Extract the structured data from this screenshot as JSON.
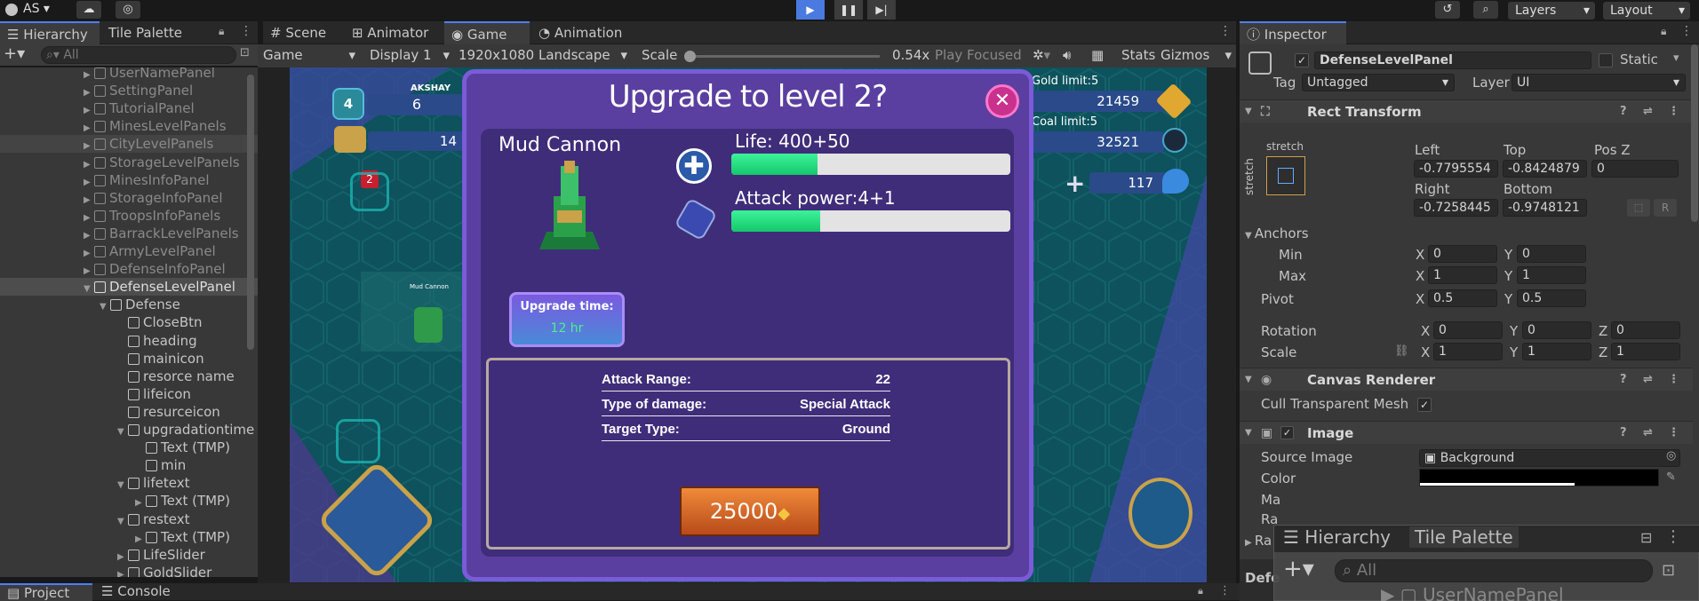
{
  "toolbar": {
    "account": "AS",
    "layers": "Layers",
    "layout": "Layout"
  },
  "hierarchy": {
    "tabs": [
      "Hierarchy",
      "Tile Palette"
    ],
    "search_placeholder": "All",
    "items": [
      {
        "label": "UserNamePanel",
        "indent": 1,
        "dim": true,
        "arrow": true
      },
      {
        "label": "SettingPanel",
        "indent": 1,
        "dim": true,
        "arrow": true
      },
      {
        "label": "TutorialPanel",
        "indent": 1,
        "dim": true,
        "arrow": true
      },
      {
        "label": "MinesLevelPanels",
        "indent": 1,
        "dim": true,
        "arrow": true
      },
      {
        "label": "CityLevelPanels",
        "indent": 1,
        "dim": true,
        "arrow": true,
        "hover": true
      },
      {
        "label": "StorageLevelPanels",
        "indent": 1,
        "dim": true,
        "arrow": true
      },
      {
        "label": "MinesInfoPanel",
        "indent": 1,
        "dim": true,
        "arrow": true
      },
      {
        "label": "StorageInfoPanel",
        "indent": 1,
        "dim": true,
        "arrow": true
      },
      {
        "label": "TroopsInfoPanels",
        "indent": 1,
        "dim": true,
        "arrow": true
      },
      {
        "label": "BarrackLevelPanels",
        "indent": 1,
        "dim": true,
        "arrow": true
      },
      {
        "label": "ArmyLevelPanel",
        "indent": 1,
        "dim": true,
        "arrow": true
      },
      {
        "label": "DefenseInfoPanel",
        "indent": 1,
        "dim": true,
        "arrow": true
      },
      {
        "label": "DefenseLevelPanel",
        "indent": 1,
        "dim": false,
        "arrow": true,
        "open": true,
        "selected": true
      },
      {
        "label": "Defense",
        "indent": 2,
        "dim": false,
        "arrow": true,
        "open": true
      },
      {
        "label": "CloseBtn",
        "indent": 3,
        "dim": false,
        "arrow": false
      },
      {
        "label": "heading",
        "indent": 3,
        "dim": false,
        "arrow": false
      },
      {
        "label": "mainicon",
        "indent": 3,
        "dim": false,
        "arrow": false
      },
      {
        "label": "resorce name",
        "indent": 3,
        "dim": false,
        "arrow": false
      },
      {
        "label": "lifeicon",
        "indent": 3,
        "dim": false,
        "arrow": false
      },
      {
        "label": "resurceicon",
        "indent": 3,
        "dim": false,
        "arrow": false
      },
      {
        "label": "upgradationtime",
        "indent": 3,
        "dim": false,
        "arrow": true,
        "open": true
      },
      {
        "label": "Text (TMP)",
        "indent": 4,
        "dim": false,
        "arrow": false
      },
      {
        "label": "min",
        "indent": 4,
        "dim": false,
        "arrow": false
      },
      {
        "label": "lifetext",
        "indent": 3,
        "dim": false,
        "arrow": true,
        "open": true
      },
      {
        "label": "Text (TMP)",
        "indent": 4,
        "dim": false,
        "arrow": true
      },
      {
        "label": "restext",
        "indent": 3,
        "dim": false,
        "arrow": true,
        "open": true
      },
      {
        "label": "Text (TMP)",
        "indent": 4,
        "dim": false,
        "arrow": true
      },
      {
        "label": "LifeSlider",
        "indent": 3,
        "dim": false,
        "arrow": true
      },
      {
        "label": "GoldSlider",
        "indent": 3,
        "dim": false,
        "arrow": true
      }
    ]
  },
  "bottom_tabs": [
    "Project",
    "Console"
  ],
  "game_view": {
    "tabs": [
      "Scene",
      "Animator",
      "Game",
      "Animation"
    ],
    "display_mode": "Game",
    "display": "Display 1",
    "resolution": "1920x1080 Landscape",
    "scale_label": "Scale",
    "scale_value": "0.54x",
    "play_focused": "Play Focused",
    "stats": "Stats",
    "gizmos": "Gizmos"
  },
  "game": {
    "player_name": "AKSHAY",
    "level": "4",
    "trophies": "6",
    "shields": "14",
    "badge": "2",
    "gold_limit": "Gold limit:5",
    "gold": "21459",
    "coal_limit": "Coal limit:5",
    "coal": "32521",
    "gems": "117",
    "unit_label": "Mud Cannon"
  },
  "dialog": {
    "title": "Upgrade to level 2?",
    "name": "Mud Cannon",
    "life_label": "Life: 400+50",
    "life_fill": 0.31,
    "attack_label": "Attack power:4+1",
    "attack_fill": 0.32,
    "upgrade_time_label": "Upgrade time:",
    "upgrade_time_value": "12 hr",
    "stats": [
      {
        "label": "Attack Range:",
        "value": "22"
      },
      {
        "label": "Type of damage:",
        "value": "Special Attack"
      },
      {
        "label": "Target Type:",
        "value": "Ground"
      }
    ],
    "cost": "25000"
  },
  "inspector": {
    "tab": "Inspector",
    "object_name": "DefenseLevelPanel",
    "static_label": "Static",
    "tag_label": "Tag",
    "tag_value": "Untagged",
    "layer_label": "Layer",
    "layer_value": "UI",
    "rect_transform": {
      "title": "Rect Transform",
      "stretch_top": "stretch",
      "stretch_side": "stretch",
      "left_label": "Left",
      "left": "-0.7795554",
      "top_label": "Top",
      "top": "-0.8424879",
      "posz_label": "Pos Z",
      "posz": "0",
      "right_label": "Right",
      "right": "-0.7258445",
      "bottom_label": "Bottom",
      "bottom": "-0.9748121",
      "anchors_label": "Anchors",
      "min_label": "Min",
      "min_x": "0",
      "min_y": "0",
      "max_label": "Max",
      "max_x": "1",
      "max_y": "1",
      "pivot_label": "Pivot",
      "pivot_x": "0.5",
      "pivot_y": "0.5",
      "rotation_label": "Rotation",
      "rot_x": "0",
      "rot_y": "0",
      "rot_z": "0",
      "scale_label": "Scale",
      "scale_x": "1",
      "scale_y": "1",
      "scale_z": "1",
      "r_button": "R"
    },
    "canvas_renderer": {
      "title": "Canvas Renderer",
      "cull_label": "Cull Transparent Mesh"
    },
    "image": {
      "title": "Image",
      "source_label": "Source Image",
      "source_value": "Background",
      "color_label": "Color",
      "ma_label": "Ma",
      "ra_label": "Ra",
      "ra2_label": "Ra"
    },
    "bottom_label": "Defe"
  },
  "drag_ghost": {
    "tabs": [
      "Hierarchy",
      "Tile Palette"
    ],
    "search": "All",
    "row": "UserNamePanel"
  }
}
